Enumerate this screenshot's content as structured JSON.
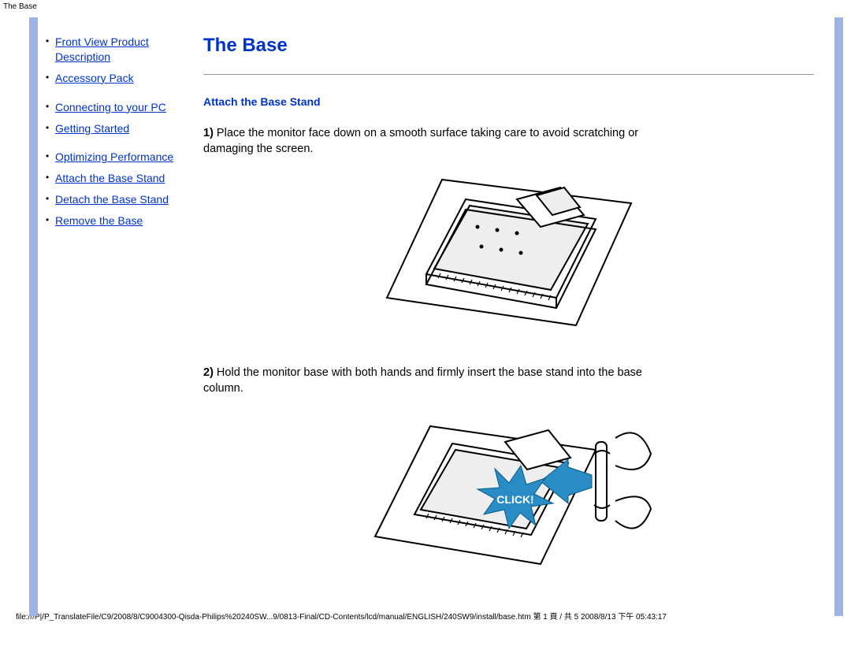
{
  "top_label": "The Base",
  "sidebar": {
    "groups": [
      [
        {
          "label": "Front View Product Description",
          "href": "#"
        },
        {
          "label": "Accessory Pack",
          "href": "#"
        }
      ],
      [
        {
          "label": "Connecting to your PC",
          "href": "#"
        },
        {
          "label": "Getting Started",
          "href": "#"
        }
      ],
      [
        {
          "label": "Optimizing Performance",
          "href": "#"
        },
        {
          "label": "Attach the Base Stand",
          "href": "#"
        },
        {
          "label": "Detach the Base Stand",
          "href": "#"
        },
        {
          "label": "Remove the Base",
          "href": "#"
        }
      ]
    ]
  },
  "main": {
    "title": "The Base",
    "section_heading": "Attach the Base Stand",
    "step1_num": "1)",
    "step1_text": " Place the monitor face down on a smooth surface taking care to avoid scratching or damaging the screen.",
    "step2_num": "2)",
    "step2_text": " Hold the monitor base with both hands and firmly insert the base stand into the base column.",
    "click_label": "CLICK!"
  },
  "footer": "file:///P|/P_TranslateFile/C9/2008/8/C9004300-Qisda-Philips%20240SW...9/0813-Final/CD-Contents/lcd/manual/ENGLISH/240SW9/install/base.htm 第 1 頁 / 共 5 2008/8/13 下午 05:43:17"
}
